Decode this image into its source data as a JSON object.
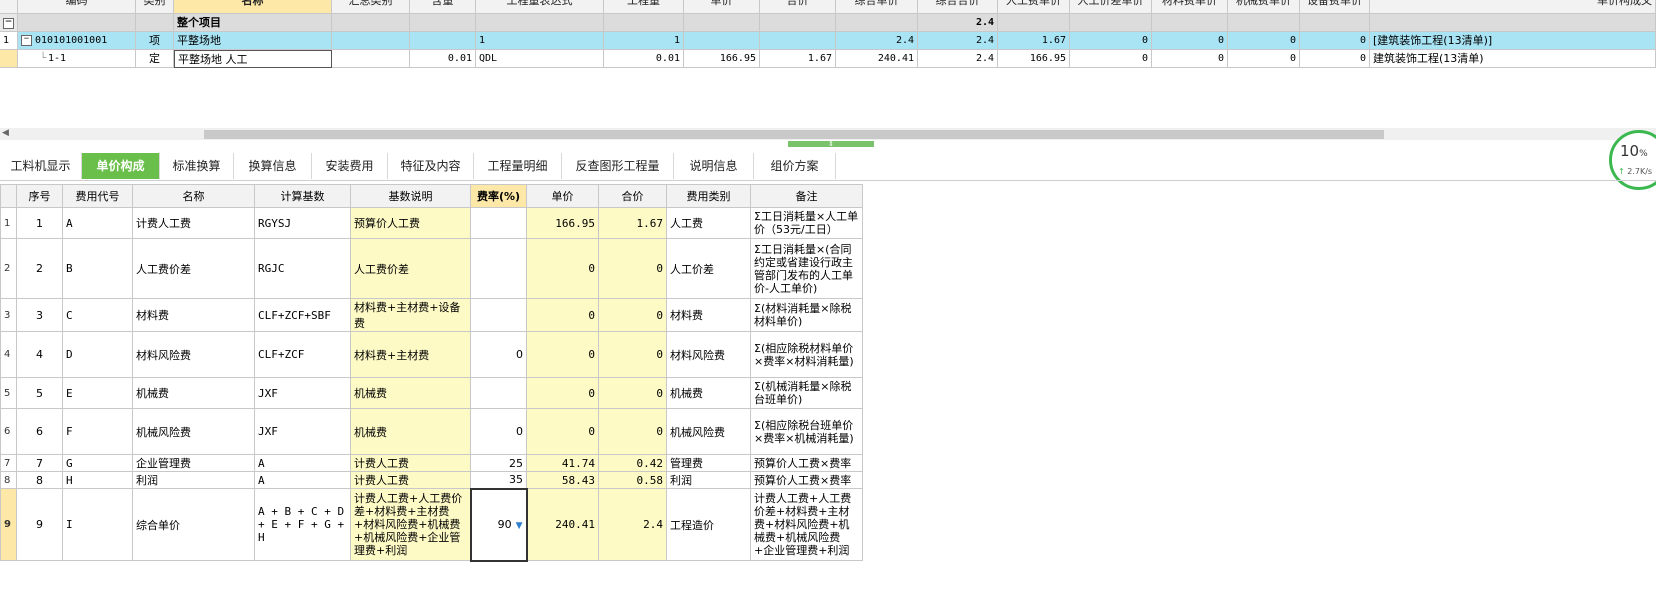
{
  "top_grid": {
    "columns": [
      "编码",
      "类别",
      "名称",
      "汇总类别",
      "含量",
      "工程量表达式",
      "工程量",
      "单价",
      "合价",
      "综合单价",
      "综合合价",
      "人工费单价",
      "人工价差单价",
      "材料费单价",
      "机械费单价",
      "设备费单价",
      "单价构成文"
    ],
    "total_row": {
      "name": "整个项目",
      "comprehensive_total": "2.4"
    },
    "item_row": {
      "rownum": "1",
      "code": "010101001001",
      "type": "项",
      "name": "平整场地",
      "expr": "1",
      "qty": "1",
      "comp_price": "2.4",
      "comp_total": "2.4",
      "labor": "1.67",
      "labor_diff": "0",
      "material": "0",
      "machine": "0",
      "equip": "0",
      "template": "[建筑装饰工程(13清单)]"
    },
    "sub_row": {
      "code": "1-1",
      "type": "定",
      "name": "平整场地 人工",
      "content": "0.01",
      "expr": "QDL",
      "qty": "0.01",
      "price": "166.95",
      "total": "1.67",
      "comp_price": "240.41",
      "comp_total": "2.4",
      "labor": "166.95",
      "labor_diff": "0",
      "material": "0",
      "machine": "0",
      "equip": "0",
      "template": "建筑装饰工程(13清单)"
    }
  },
  "tabs": [
    "工料机显示",
    "单价构成",
    "标准换算",
    "换算信息",
    "安装费用",
    "特征及内容",
    "工程量明细",
    "反查图形工程量",
    "说明信息",
    "组价方案"
  ],
  "active_tab": "单价构成",
  "net_widget": {
    "percent": "10",
    "unit": "%",
    "speed": "2.7K/s"
  },
  "detail": {
    "headers": [
      "序号",
      "费用代号",
      "名称",
      "计算基数",
      "基数说明",
      "费率(%)",
      "单价",
      "合价",
      "费用类别",
      "备注"
    ],
    "rows": [
      {
        "rn": "1",
        "seq": "1",
        "code": "A",
        "name": "计费人工费",
        "base": "RGYSJ",
        "desc": "预算价人工费",
        "rate": "",
        "price": "166.95",
        "total": "1.67",
        "cat": "人工费",
        "note": "Σ工日消耗量×人工单价（53元/工日）"
      },
      {
        "rn": "2",
        "seq": "2",
        "code": "B",
        "name": "人工费价差",
        "base": "RGJC",
        "desc": "人工费价差",
        "rate": "",
        "price": "0",
        "total": "0",
        "cat": "人工价差",
        "note": "Σ工日消耗量×(合同约定或省建设行政主管部门发布的人工单价-人工单价)"
      },
      {
        "rn": "3",
        "seq": "3",
        "code": "C",
        "name": "材料费",
        "base": "CLF+ZCF+SBF",
        "desc": "材料费+主材费+设备费",
        "rate": "",
        "price": "0",
        "total": "0",
        "cat": "材料费",
        "note": "Σ(材料消耗量×除税材料单价)"
      },
      {
        "rn": "4",
        "seq": "4",
        "code": "D",
        "name": "材料风险费",
        "base": "CLF+ZCF",
        "desc": "材料费+主材费",
        "rate": "0",
        "price": "0",
        "total": "0",
        "cat": "材料风险费",
        "note": "Σ(相应除税材料单价×费率×材料消耗量)"
      },
      {
        "rn": "5",
        "seq": "5",
        "code": "E",
        "name": "机械费",
        "base": "JXF",
        "desc": "机械费",
        "rate": "",
        "price": "0",
        "total": "0",
        "cat": "机械费",
        "note": "Σ(机械消耗量×除税台班单价)"
      },
      {
        "rn": "6",
        "seq": "6",
        "code": "F",
        "name": "机械风险费",
        "base": "JXF",
        "desc": "机械费",
        "rate": "0",
        "price": "0",
        "total": "0",
        "cat": "机械风险费",
        "note": "Σ(相应除税台班单价×费率×机械消耗量)"
      },
      {
        "rn": "7",
        "seq": "7",
        "code": "G",
        "name": "企业管理费",
        "base": "A",
        "desc": "计费人工费",
        "rate": "25",
        "price": "41.74",
        "total": "0.42",
        "cat": "管理费",
        "note": "预算价人工费×费率"
      },
      {
        "rn": "8",
        "seq": "8",
        "code": "H",
        "name": "利润",
        "base": "A",
        "desc": "计费人工费",
        "rate": "35",
        "price": "58.43",
        "total": "0.58",
        "cat": "利润",
        "note": "预算价人工费×费率"
      },
      {
        "rn": "9",
        "seq": "9",
        "code": "I",
        "name": "综合单价",
        "base": "A + B + C + D + E + F + G + H",
        "desc": "计费人工费+人工费价差+材料费+主材费+材料风险费+机械费+机械风险费+企业管理费+利润",
        "rate": "90",
        "price": "240.41",
        "total": "2.4",
        "cat": "工程造价",
        "note": "计费人工费+人工费价差+材料费+主材费+材料风险费+机械费+机械风险费+企业管理费+利润"
      }
    ]
  },
  "colors": {
    "accent_green": "#6abf4b",
    "item_row_blue": "#a9e4f5",
    "editable_yellow": "#fdfac6",
    "selected_header": "#fde8a8"
  }
}
